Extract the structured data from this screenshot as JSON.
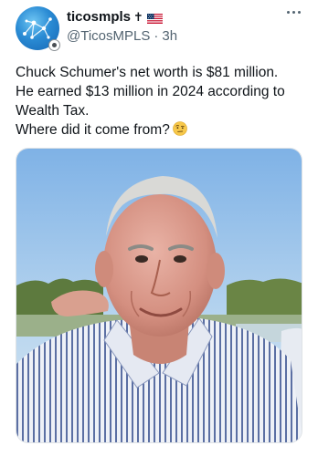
{
  "post": {
    "author": {
      "display_name": "ticosmpls",
      "name_suffix": "✝",
      "flag_icon": "us-flag-icon",
      "handle": "@TicosMPLS",
      "separator": "·",
      "time": "3h"
    },
    "text_lines": [
      "Chuck Schumer's net worth is $81 million.",
      "He earned $13 million in 2024 according to",
      "Wealth Tax.",
      "Where did it come from?"
    ],
    "trailing_emoji": "face-with-raised-eyebrow-icon",
    "menu_icon": "more-options-icon",
    "media_icon": "photo-of-smiling-older-man"
  },
  "colors": {
    "text": "#0f1419",
    "secondary": "#536471",
    "avatar_blue": "#2a8bd4"
  }
}
